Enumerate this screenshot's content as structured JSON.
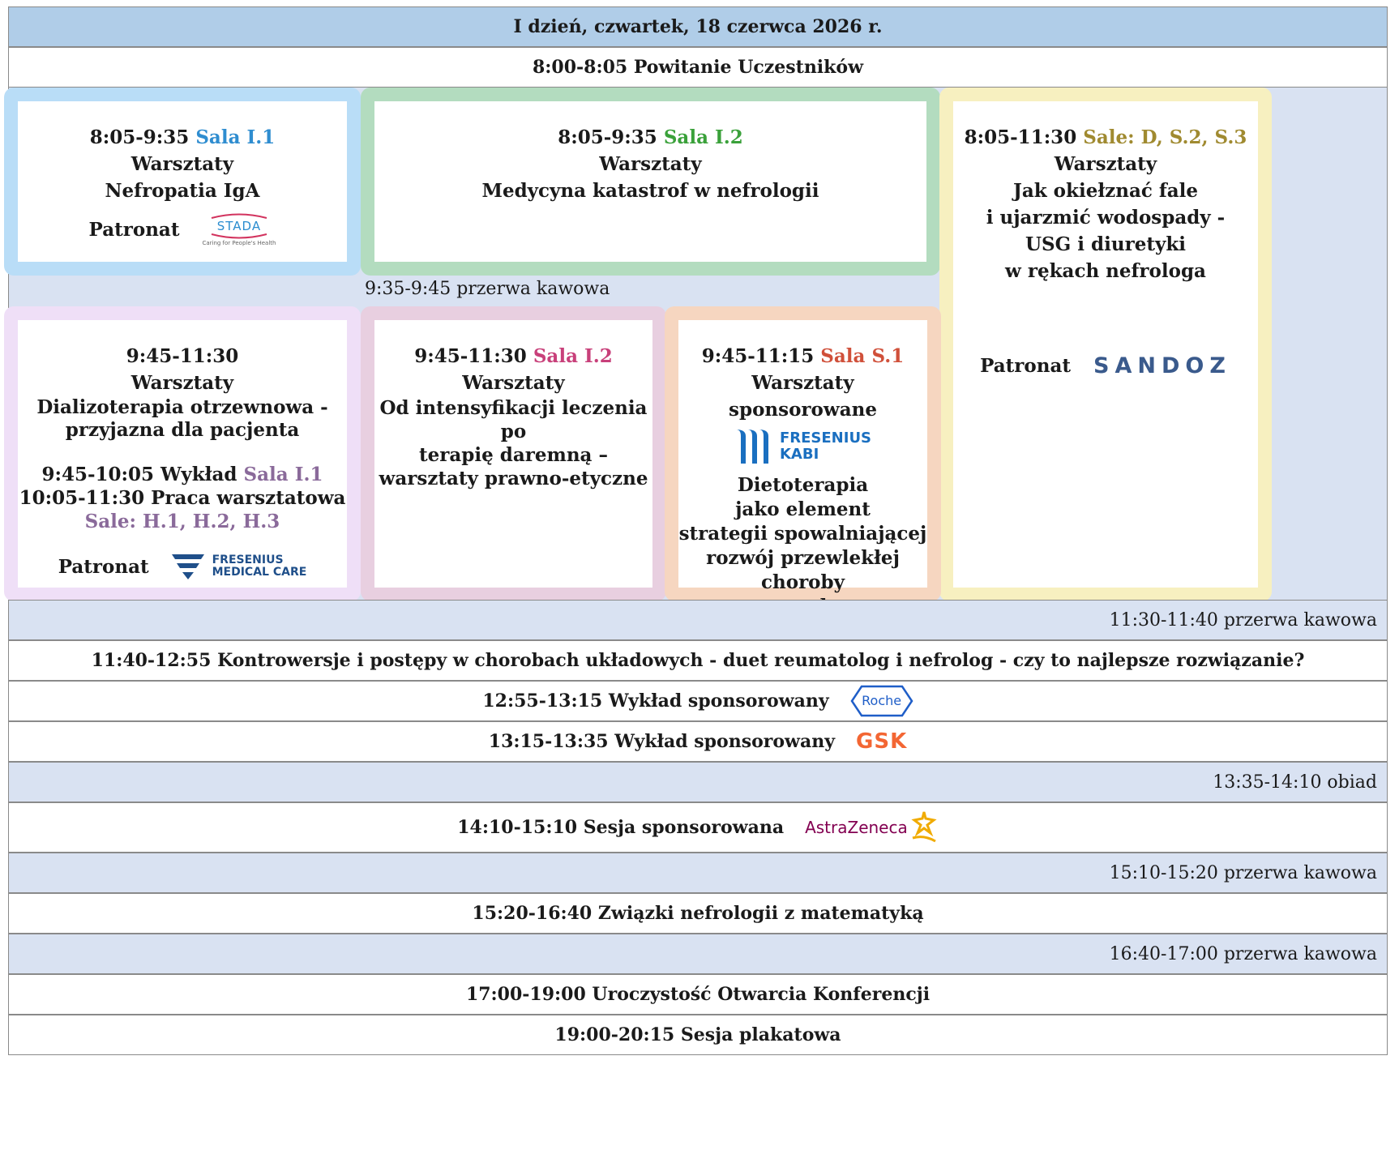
{
  "header": {
    "title": "I dzień, czwartek, 18 czerwca 2026 r."
  },
  "welcome": "8:00-8:05 Powitanie Uczestników",
  "box1": {
    "time": "8:05-9:35",
    "room": "Sala I.1",
    "line1": "Warsztaty",
    "line2": "Nefropatia IgA",
    "patron_label": "Patronat",
    "logo_text": "STADA",
    "logo_tagline": "Caring for People's Health",
    "color": "#2f8dd0"
  },
  "box2": {
    "time": "8:05-9:35",
    "room": "Sala I.2",
    "line1": "Warsztaty",
    "line2": "Medycyna katastrof w nefrologii",
    "color": "#3aa13a"
  },
  "box3": {
    "time": "8:05-11:30",
    "room": "Sale: D, S.2, S.3",
    "line1": "Warsztaty",
    "line2": "Jak okiełznać fale",
    "line3": "i ujarzmić wodospady -",
    "line4": "USG i diuretyki",
    "line5": "w rękach nefrologa",
    "patron_label": "Patronat",
    "logo_text": "SANDOZ",
    "color": "#a08a30"
  },
  "break1": "9:35-9:45 przerwa kawowa",
  "box4": {
    "time": "9:45-11:30",
    "line1": "Warsztaty",
    "line2": "Dializoterapia otrzewnowa -",
    "line3": "przyjazna dla pacjenta",
    "sub1_time": "9:45-10:05 Wykład",
    "sub1_room": "Sala I.1",
    "sub2": "10:05-11:30 Praca warsztatowa",
    "sub3": "Sale: H.1, H.2, H.3",
    "patron_label": "Patronat",
    "logo_line1": "FRESENIUS",
    "logo_line2": "MEDICAL CARE",
    "color": "#8a6a9a"
  },
  "box5": {
    "time": "9:45-11:30",
    "room": "Sala I.2",
    "line1": "Warsztaty",
    "line2": "Od intensyfikacji leczenia po",
    "line3": "terapię daremną –",
    "line4": "warsztaty prawno-etyczne",
    "color": "#c8407a"
  },
  "box6": {
    "time": "9:45-11:15",
    "room": "Sala S.1",
    "line1": "Warsztaty",
    "line2": "sponsorowane",
    "logo_line1": "FRESENIUS",
    "logo_line2": "KABI",
    "line3": "Dietoterapia",
    "line4": "jako element",
    "line5": "strategii spowalniającej",
    "line6": "rozwój przewlekłej choroby",
    "line7": "nerek",
    "color": "#d0503a"
  },
  "rows": {
    "break2": "11:30-11:40 przerwa kawowa",
    "session1": "11:40-12:55  Kontrowersje i postępy w chorobach układowych - duet reumatolog i nefrolog - czy to najlepsze rozwiązanie?",
    "lecture1": "12:55-13:15 Wykład sponsorowany",
    "lecture1_logo": "Roche",
    "lecture2": "13:15-13:35 Wykład sponsorowany",
    "lecture2_logo": "GSK",
    "lunch": "13:35-14:10 obiad",
    "session2": "14:10-15:10  Sesja sponsorowana",
    "session2_logo": "AstraZeneca",
    "break3": "15:10-15:20 przerwa kawowa",
    "session3": "15:20-16:40  Związki nefrologii z matematyką",
    "break4": "16:40-17:00 przerwa kawowa",
    "opening": "17:00-19:00 Uroczystość Otwarcia Konferencji",
    "poster": "19:00-20:15 Sesja plakatowa"
  }
}
